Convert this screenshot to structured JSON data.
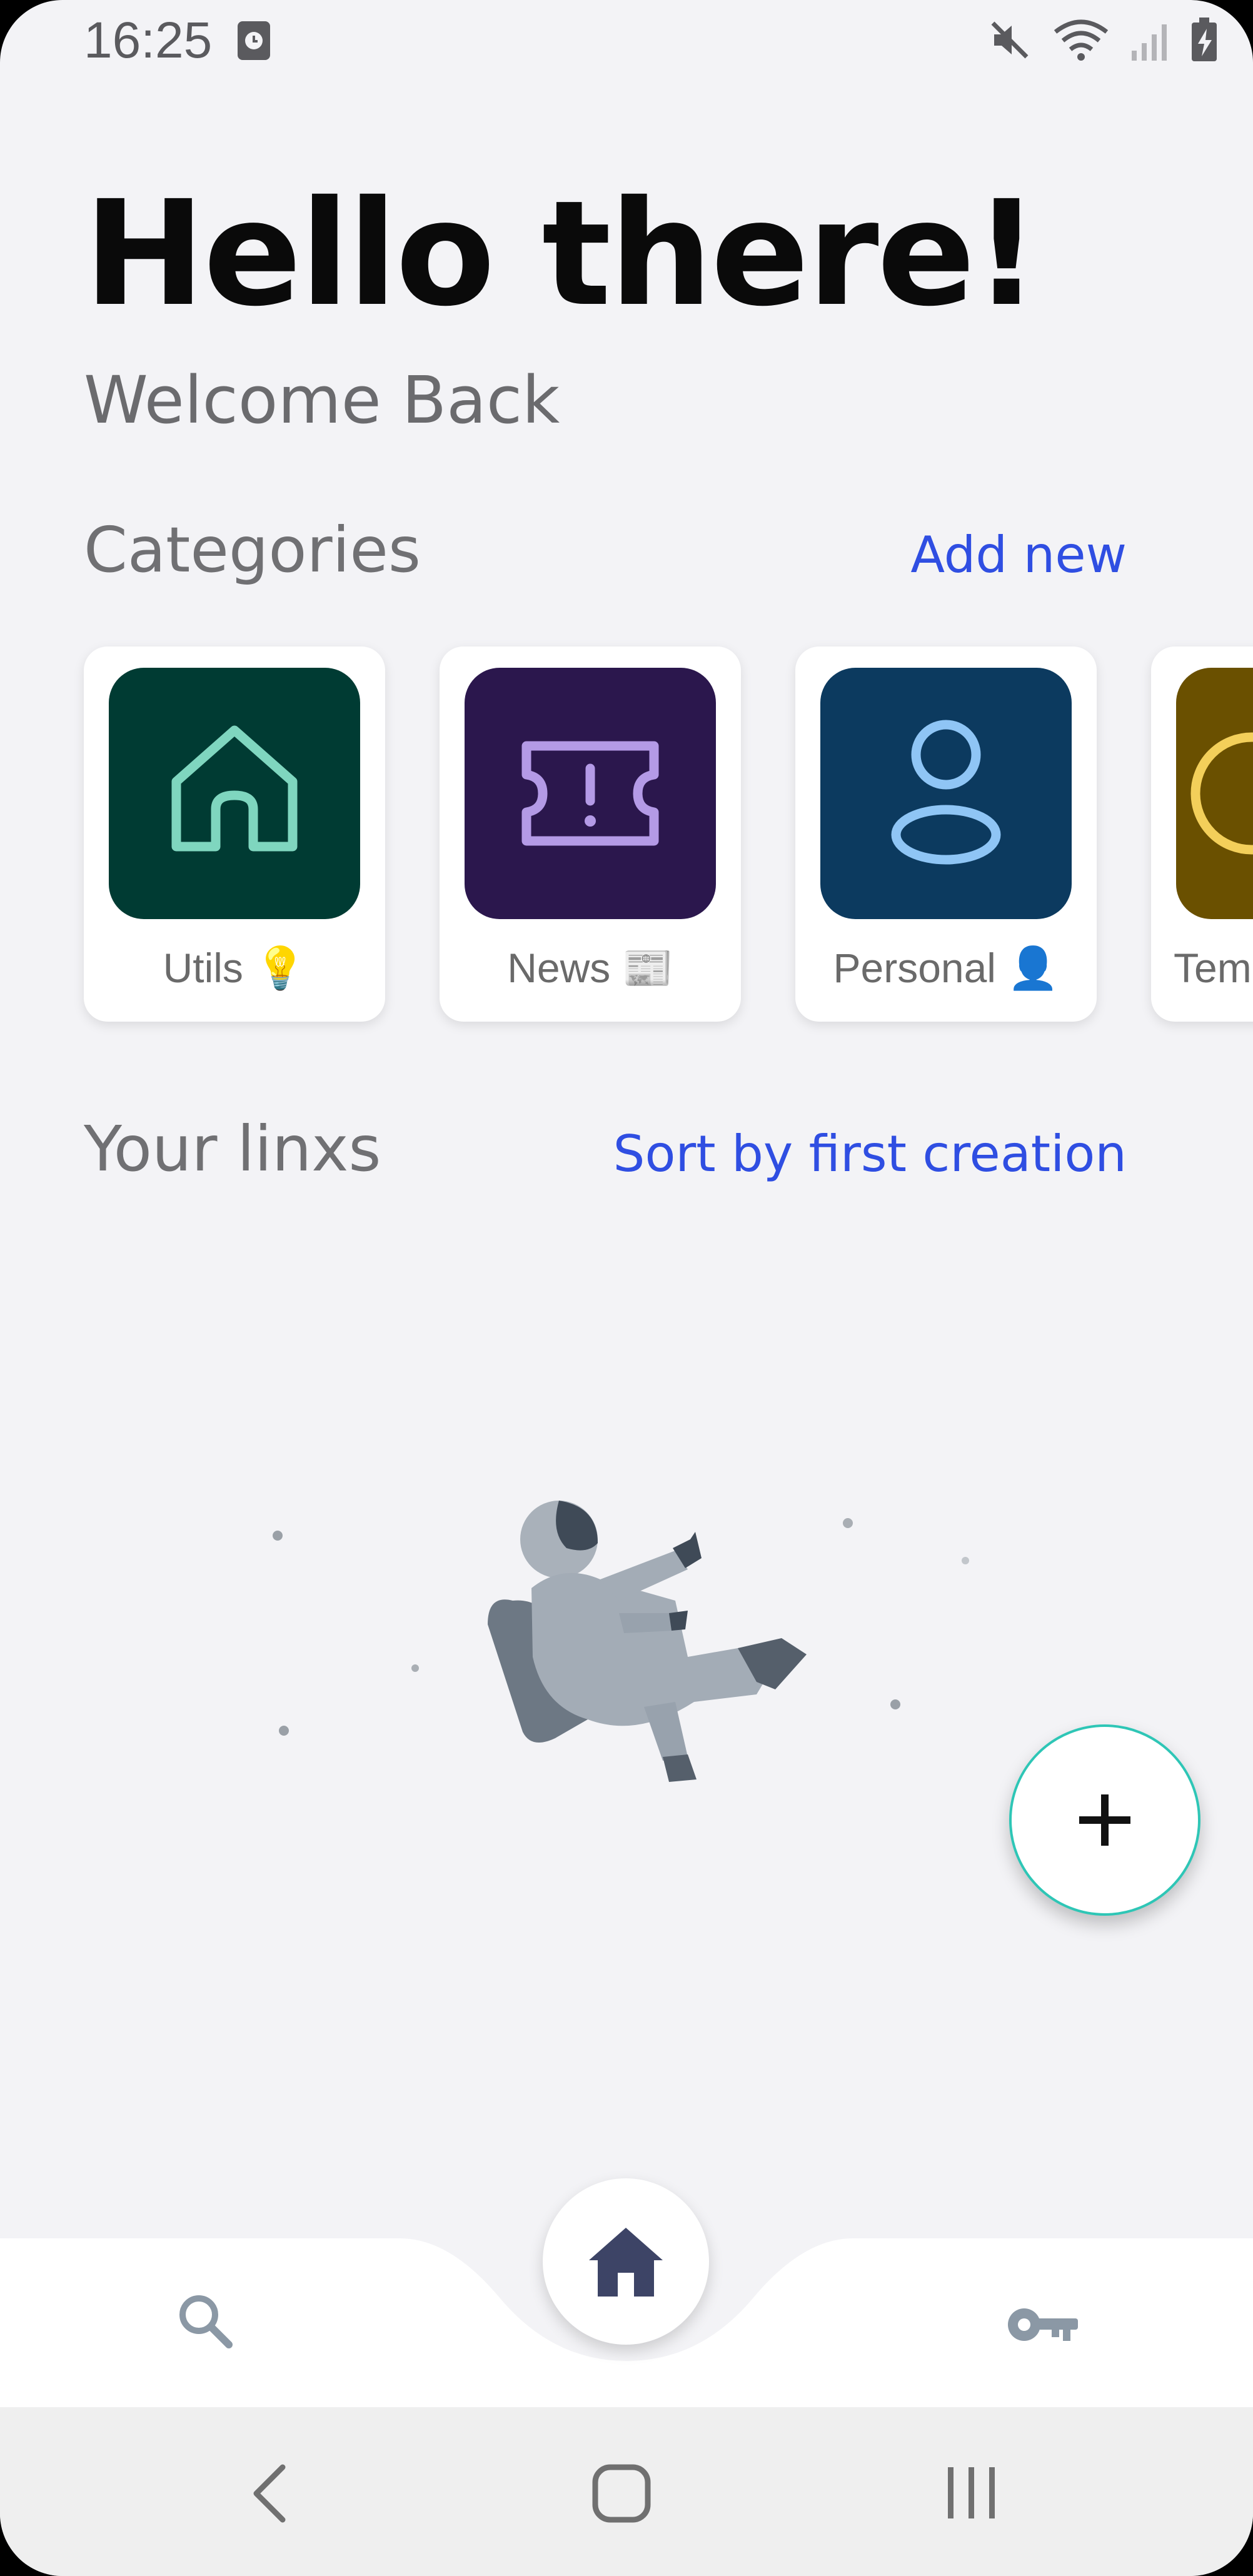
{
  "status_bar": {
    "time": "16:25",
    "icons": [
      "alarm-icon",
      "mute-icon",
      "wifi-icon",
      "signal-icon",
      "battery-charging-icon"
    ]
  },
  "header": {
    "greeting": "Hello there!",
    "subtitle": "Welcome Back"
  },
  "categories": {
    "title": "Categories",
    "action": "Add new",
    "items": [
      {
        "label": "Utils 💡",
        "icon": "home-icon",
        "tile_color": "#003b33",
        "icon_color": "#7fd6bf"
      },
      {
        "label": "News 📰",
        "icon": "ticket-icon",
        "tile_color": "#2b174d",
        "icon_color": "#b49ae6"
      },
      {
        "label": "Personal 👤",
        "icon": "user-icon",
        "tile_color": "#0c3a5f",
        "icon_color": "#8fc5f5"
      },
      {
        "label": "Tem",
        "icon": "circle-icon",
        "tile_color": "#6a5000",
        "icon_color": "#f3cf5a"
      }
    ]
  },
  "links": {
    "title": "Your linxs",
    "action": "Sort by first creation",
    "empty_state_icon": "astronaut-illustration"
  },
  "fab": {
    "icon": "plus-icon",
    "accent": "#2ec6b6"
  },
  "bottom_nav": {
    "items": [
      "search-icon",
      "home-icon",
      "key-icon"
    ],
    "active": "home-icon",
    "active_color": "#3d4466",
    "inactive_color": "#8b98a5"
  },
  "system_nav": {
    "items": [
      "back-icon",
      "home-circle-icon",
      "recents-icon"
    ]
  },
  "colors": {
    "accent_link": "#2f4ee2",
    "background": "#f3f3f6"
  }
}
